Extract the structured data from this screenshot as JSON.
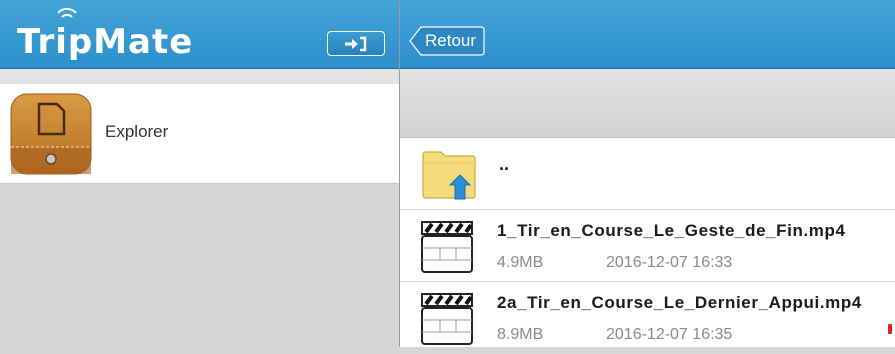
{
  "app": {
    "brand": "TripMate"
  },
  "header": {
    "back_label": "Retour"
  },
  "sidebar": {
    "items": [
      {
        "label": "Explorer",
        "icon": "explorer-icon"
      }
    ]
  },
  "files": {
    "parent": {
      "label": ".."
    },
    "items": [
      {
        "name": "1_Tir_en_Course_Le_Geste_de_Fin.mp4",
        "size": "4.9MB",
        "date": "2016-12-07 16:33",
        "icon": "video-clapper-icon"
      },
      {
        "name": "2a_Tir_en_Course_Le_Dernier_Appui.mp4",
        "size": "8.9MB",
        "date": "2016-12-07 16:35",
        "icon": "video-clapper-icon"
      }
    ]
  },
  "colors": {
    "header_blue": "#2c8fcb",
    "sidebar_bg": "#d6d6d6",
    "list_bg": "#ffffff",
    "meta_gray": "#8a8a8a"
  }
}
